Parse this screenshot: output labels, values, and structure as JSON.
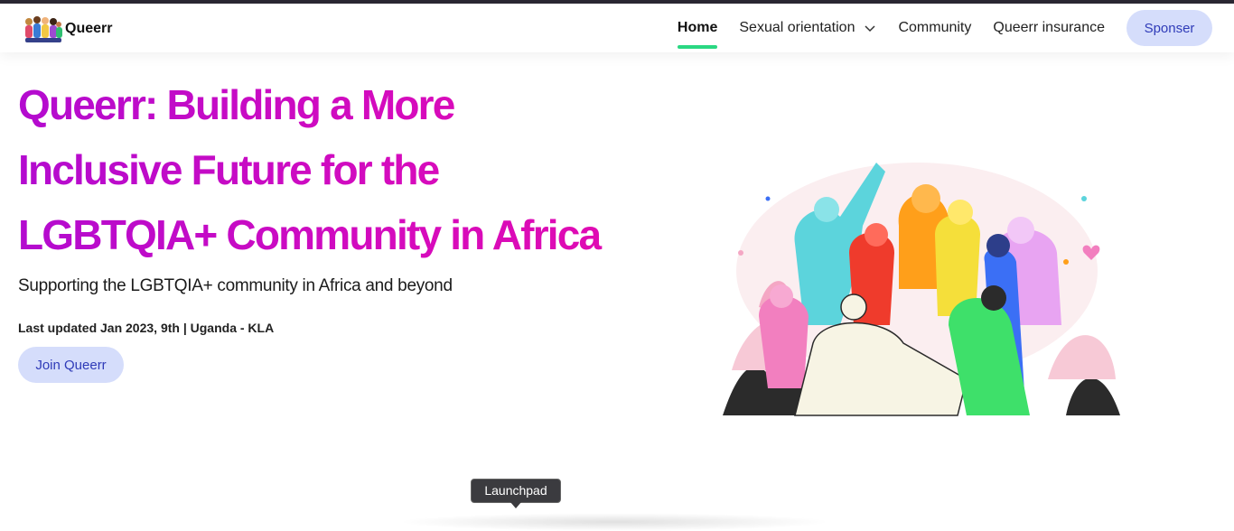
{
  "brand": {
    "name": "Queerr",
    "logo_icon": "people-group-logo"
  },
  "nav": {
    "items": [
      {
        "label": "Home",
        "active": true
      },
      {
        "label": "Sexual orientation",
        "active": false,
        "has_dropdown": true
      },
      {
        "label": "Community",
        "active": false
      },
      {
        "label": "Queerr insurance",
        "active": false
      }
    ],
    "sponsor_label": "Sponser"
  },
  "hero": {
    "title_lines": [
      "Queerr: Building a More",
      "Inclusive Future for the",
      "LGBTQIA+ Community in Africa"
    ],
    "subtitle": "Supporting the LGBTQIA+ community in Africa and beyond",
    "meta": "Last updated Jan 2023, 9th | Uganda - KLA",
    "cta_label": "Join Queerr",
    "illustration": "diverse-people-celebrating-illustration"
  },
  "dock": {
    "tooltip": "Launchpad"
  },
  "colors": {
    "title_gradient": [
      "#b30bcf",
      "#e20bb0"
    ],
    "button_bg": "#d5ddfb",
    "button_text": "#2f3bb8",
    "active_underline": "#2ad882"
  }
}
